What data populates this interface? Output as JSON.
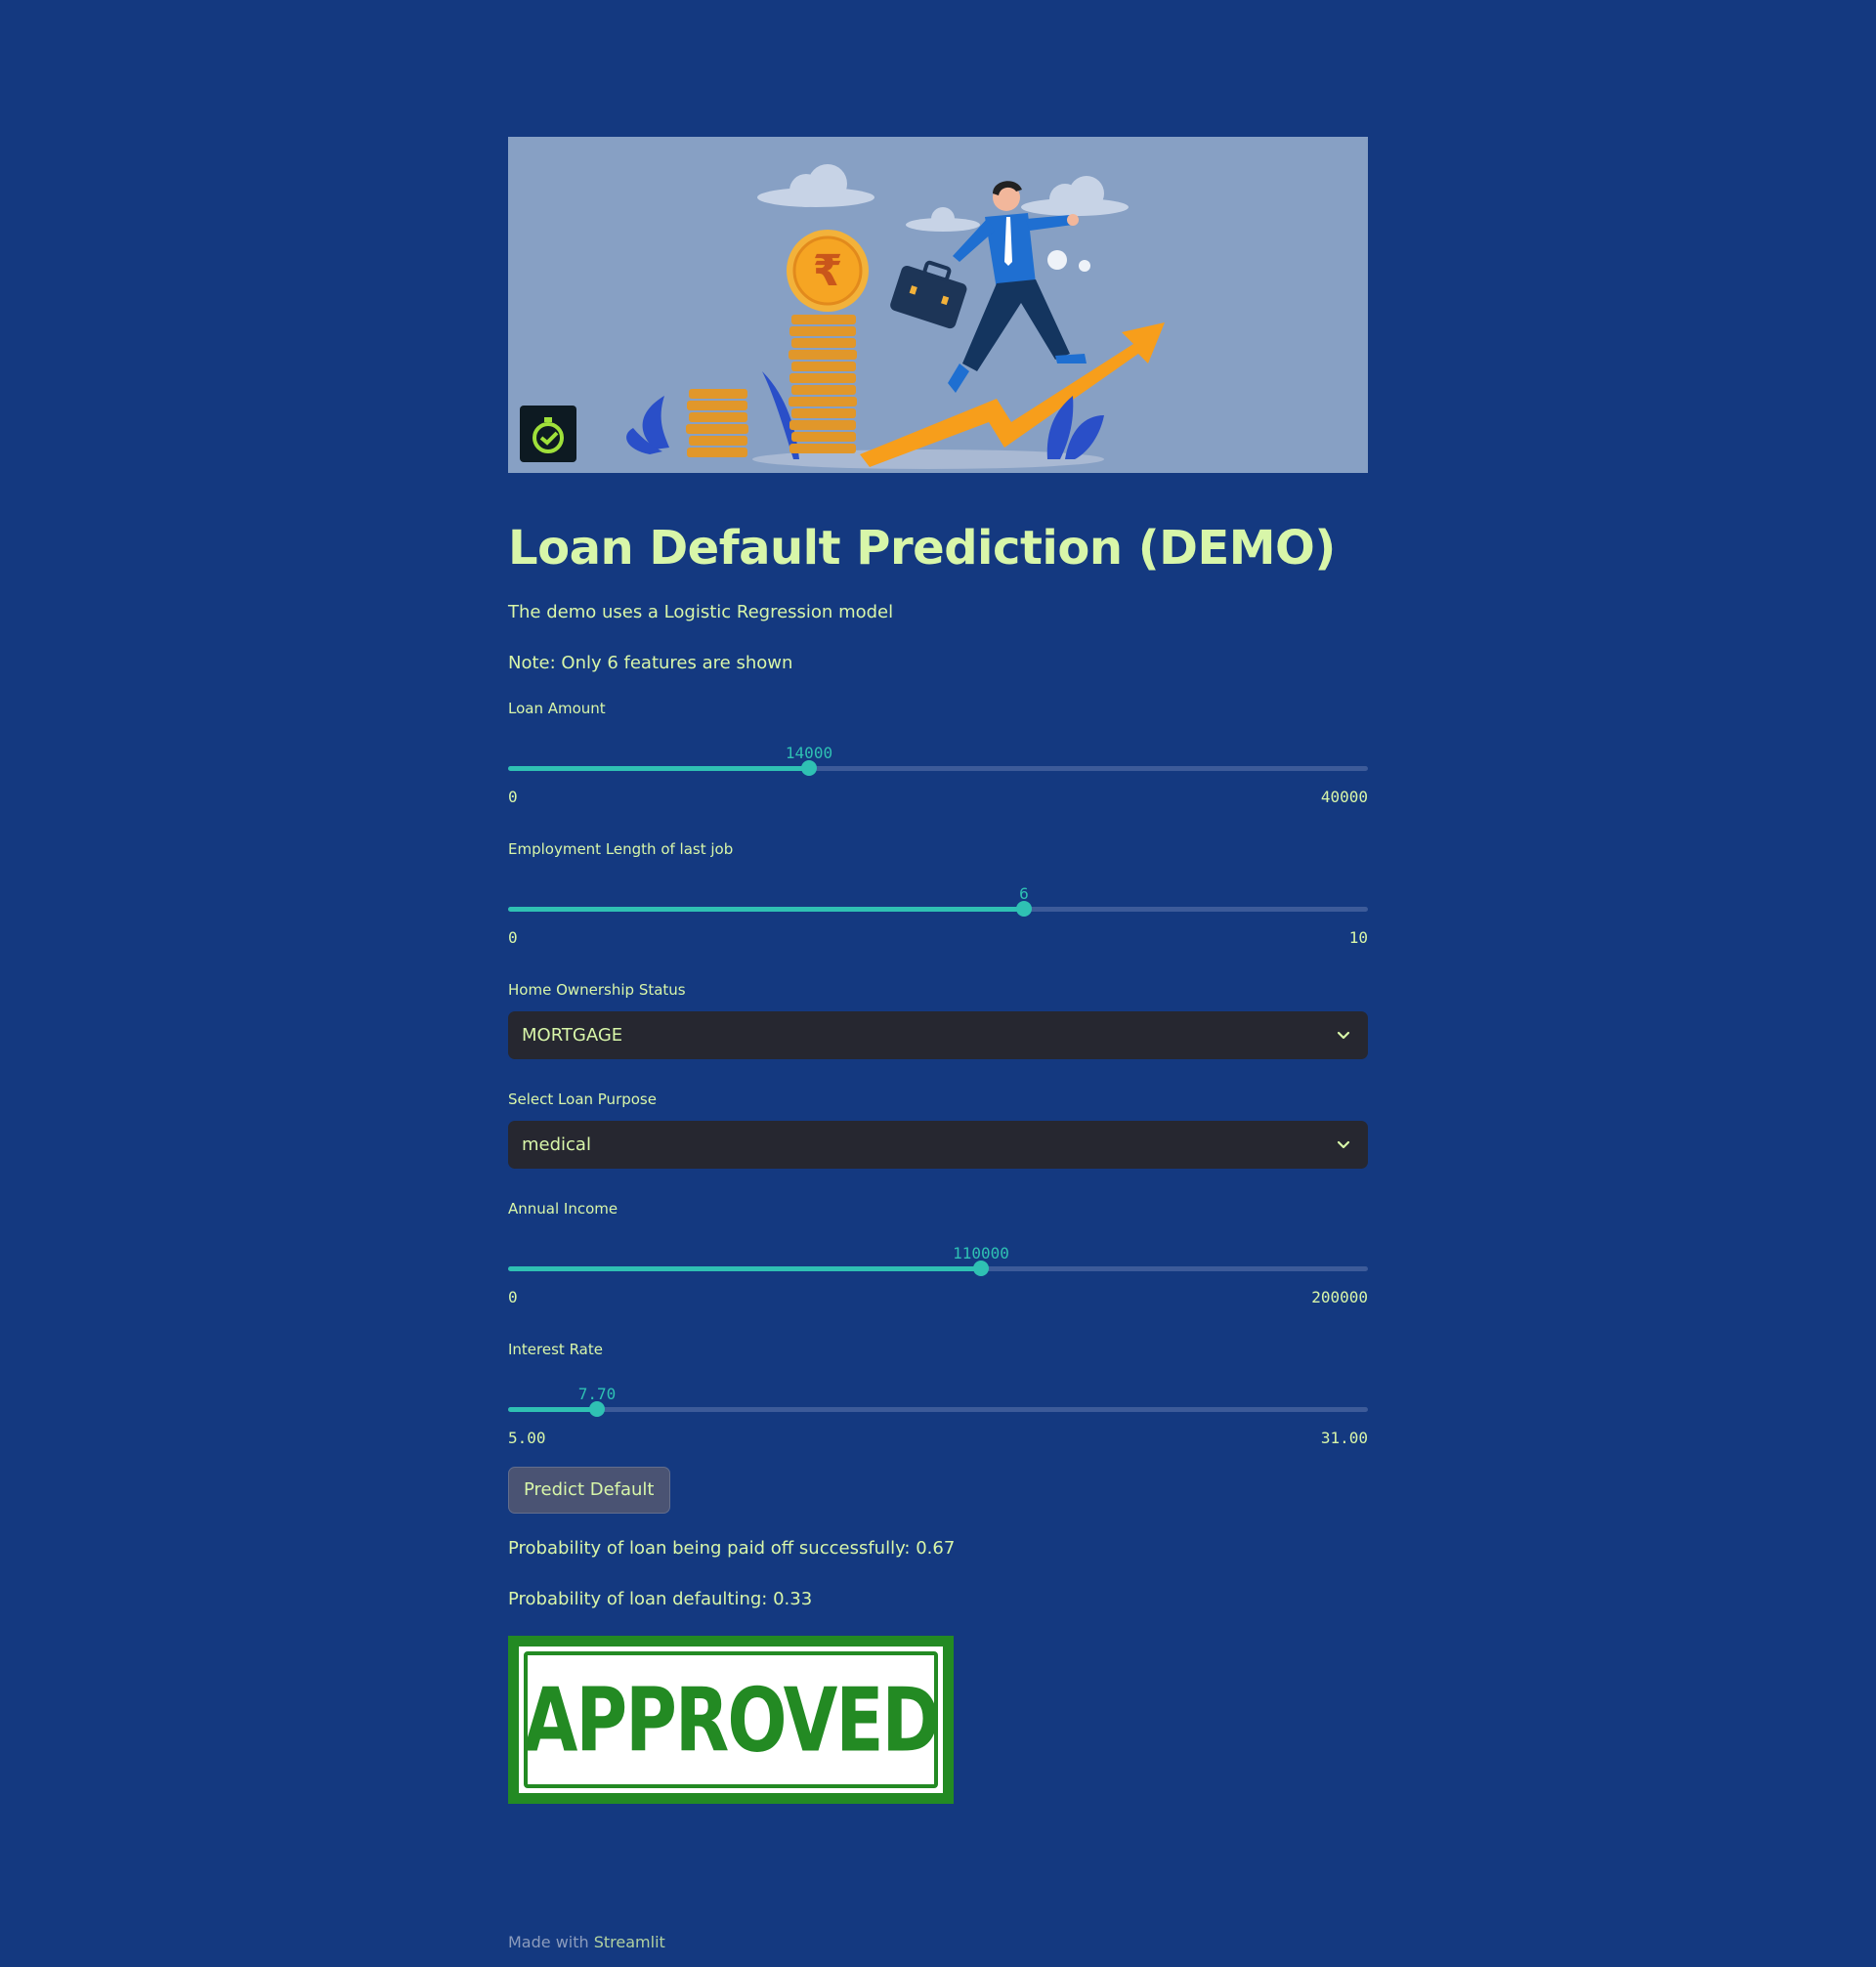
{
  "app": {
    "title": "Loan Default Prediction (DEMO)",
    "description": "The demo uses a Logistic Regression model",
    "note": "Note: Only 6 features are shown"
  },
  "banner": {
    "icon": "rupee-coin-businessman-illustration",
    "logo_icon": "stopwatch-logo-icon"
  },
  "form": {
    "loan_amount": {
      "label": "Loan Amount",
      "value": "14000",
      "min": "0",
      "max": "40000",
      "fraction": 0.35
    },
    "employment_length": {
      "label": "Employment Length of last job",
      "value": "6",
      "min": "0",
      "max": "10",
      "fraction": 0.6
    },
    "home_ownership": {
      "label": "Home Ownership Status",
      "selected": "MORTGAGE"
    },
    "loan_purpose": {
      "label": "Select Loan Purpose",
      "selected": "medical"
    },
    "annual_income": {
      "label": "Annual Income",
      "value": "110000",
      "min": "0",
      "max": "200000",
      "fraction": 0.55
    },
    "interest_rate": {
      "label": "Interest Rate",
      "value": "7.70",
      "min": "5.00",
      "max": "31.00",
      "fraction": 0.1038
    },
    "predict_button": "Predict Default"
  },
  "results": {
    "paid_off": "Probability of loan being paid off successfully: 0.67",
    "default": "Probability of loan defaulting: 0.33",
    "stamp": "APPROVED"
  },
  "footer": {
    "prefix": "Made with",
    "brand": "Streamlit"
  },
  "colors": {
    "background": "#143980",
    "text": "#d8f6a9",
    "accent": "#2fc1b3",
    "select_bg": "#262730",
    "stamp_green": "#238a23"
  }
}
